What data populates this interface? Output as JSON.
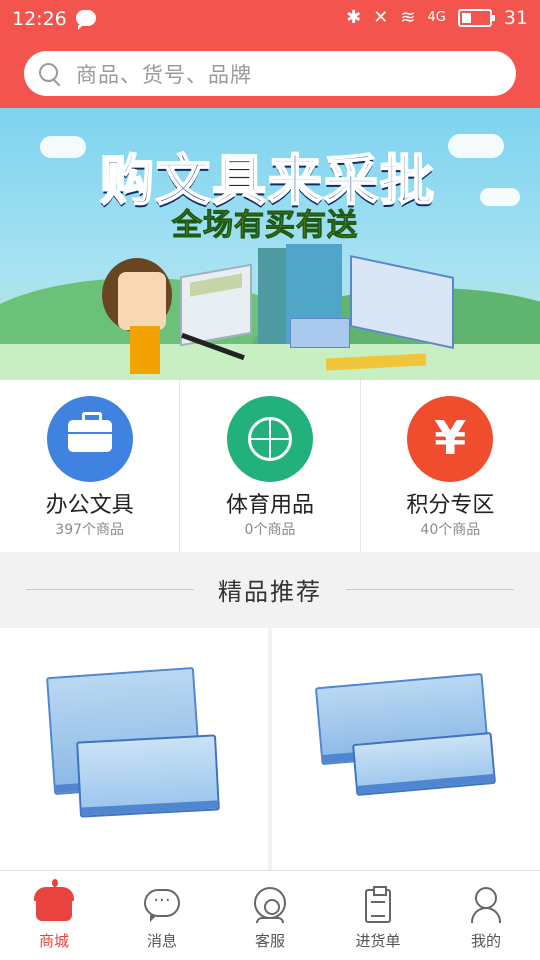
{
  "status_bar": {
    "time": "12:26",
    "battery": "31",
    "network": "4G"
  },
  "search": {
    "placeholder": "商品、货号、品牌"
  },
  "banner": {
    "title": "购文具来采批",
    "subtitle": "全场有买有送",
    "slides": 3,
    "active_slide": 1
  },
  "categories": [
    {
      "name": "办公文具",
      "count": "397个商品",
      "icon": "briefcase-icon",
      "color": "#3f82e0"
    },
    {
      "name": "体育用品",
      "count": "0个商品",
      "icon": "basketball-icon",
      "color": "#22b07d"
    },
    {
      "name": "积分专区",
      "count": "40个商品",
      "icon": "yen-icon",
      "color": "#f04d2e",
      "symbol": "¥"
    }
  ],
  "section": {
    "title": "精品推荐"
  },
  "products": [
    {
      "image": "receipt-book-stack-icon"
    },
    {
      "image": "receipt-book-stack-icon"
    }
  ],
  "bottom_nav": {
    "items": [
      {
        "label": "商城",
        "icon": "shop-icon",
        "active": true
      },
      {
        "label": "消息",
        "icon": "message-icon",
        "active": false
      },
      {
        "label": "客服",
        "icon": "customer-service-icon",
        "active": false
      },
      {
        "label": "进货单",
        "icon": "clipboard-icon",
        "active": false
      },
      {
        "label": "我的",
        "icon": "user-icon",
        "active": false
      }
    ]
  },
  "colors": {
    "accent": "#f4544e",
    "active_nav": "#e8433c"
  }
}
